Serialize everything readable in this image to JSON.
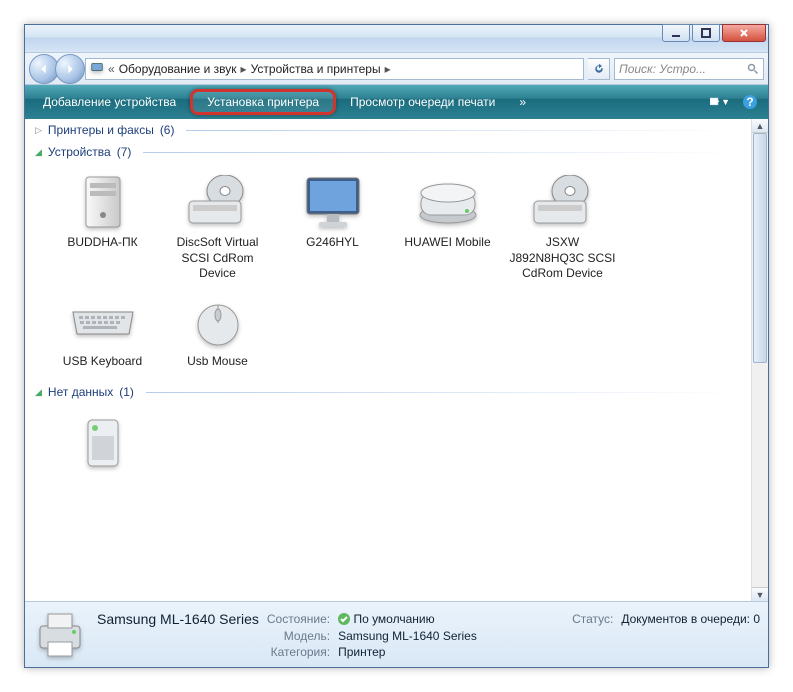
{
  "breadcrumb": {
    "seg1": "Оборудование и звук",
    "seg2": "Устройства и принтеры"
  },
  "search_placeholder": "Поиск: Устро...",
  "commands": {
    "add_device": "Добавление устройства",
    "install_printer": "Установка принтера",
    "print_queue": "Просмотр очереди печати",
    "more": "»"
  },
  "groups": {
    "printers": {
      "title": "Принтеры и факсы",
      "count": "(6)"
    },
    "devices": {
      "title": "Устройства",
      "count": "(7)"
    },
    "nodata": {
      "title": "Нет данных",
      "count": "(1)"
    }
  },
  "devices": [
    {
      "label": "BUDDHA-ПК",
      "icon": "tower"
    },
    {
      "label": "DiscSoft Virtual SCSI CdRom Device",
      "icon": "optical"
    },
    {
      "label": "G246HYL",
      "icon": "monitor"
    },
    {
      "label": "HUAWEI Mobile",
      "icon": "drive"
    },
    {
      "label": "JSXW J892N8HQ3C SCSI CdRom Device",
      "icon": "optical"
    },
    {
      "label": "USB Keyboard",
      "icon": "keyboard"
    },
    {
      "label": "Usb Mouse",
      "icon": "mouse"
    }
  ],
  "nodata_item": {
    "label": "",
    "icon": "unknown"
  },
  "detail": {
    "title": "Samsung ML-1640 Series",
    "state_label": "Состояние:",
    "state_value": "По умолчанию",
    "model_label": "Модель:",
    "model_value": "Samsung ML-1640 Series",
    "cat_label": "Категория:",
    "cat_value": "Принтер",
    "status_label": "Статус:",
    "status_value": "Документов в очереди: 0"
  }
}
